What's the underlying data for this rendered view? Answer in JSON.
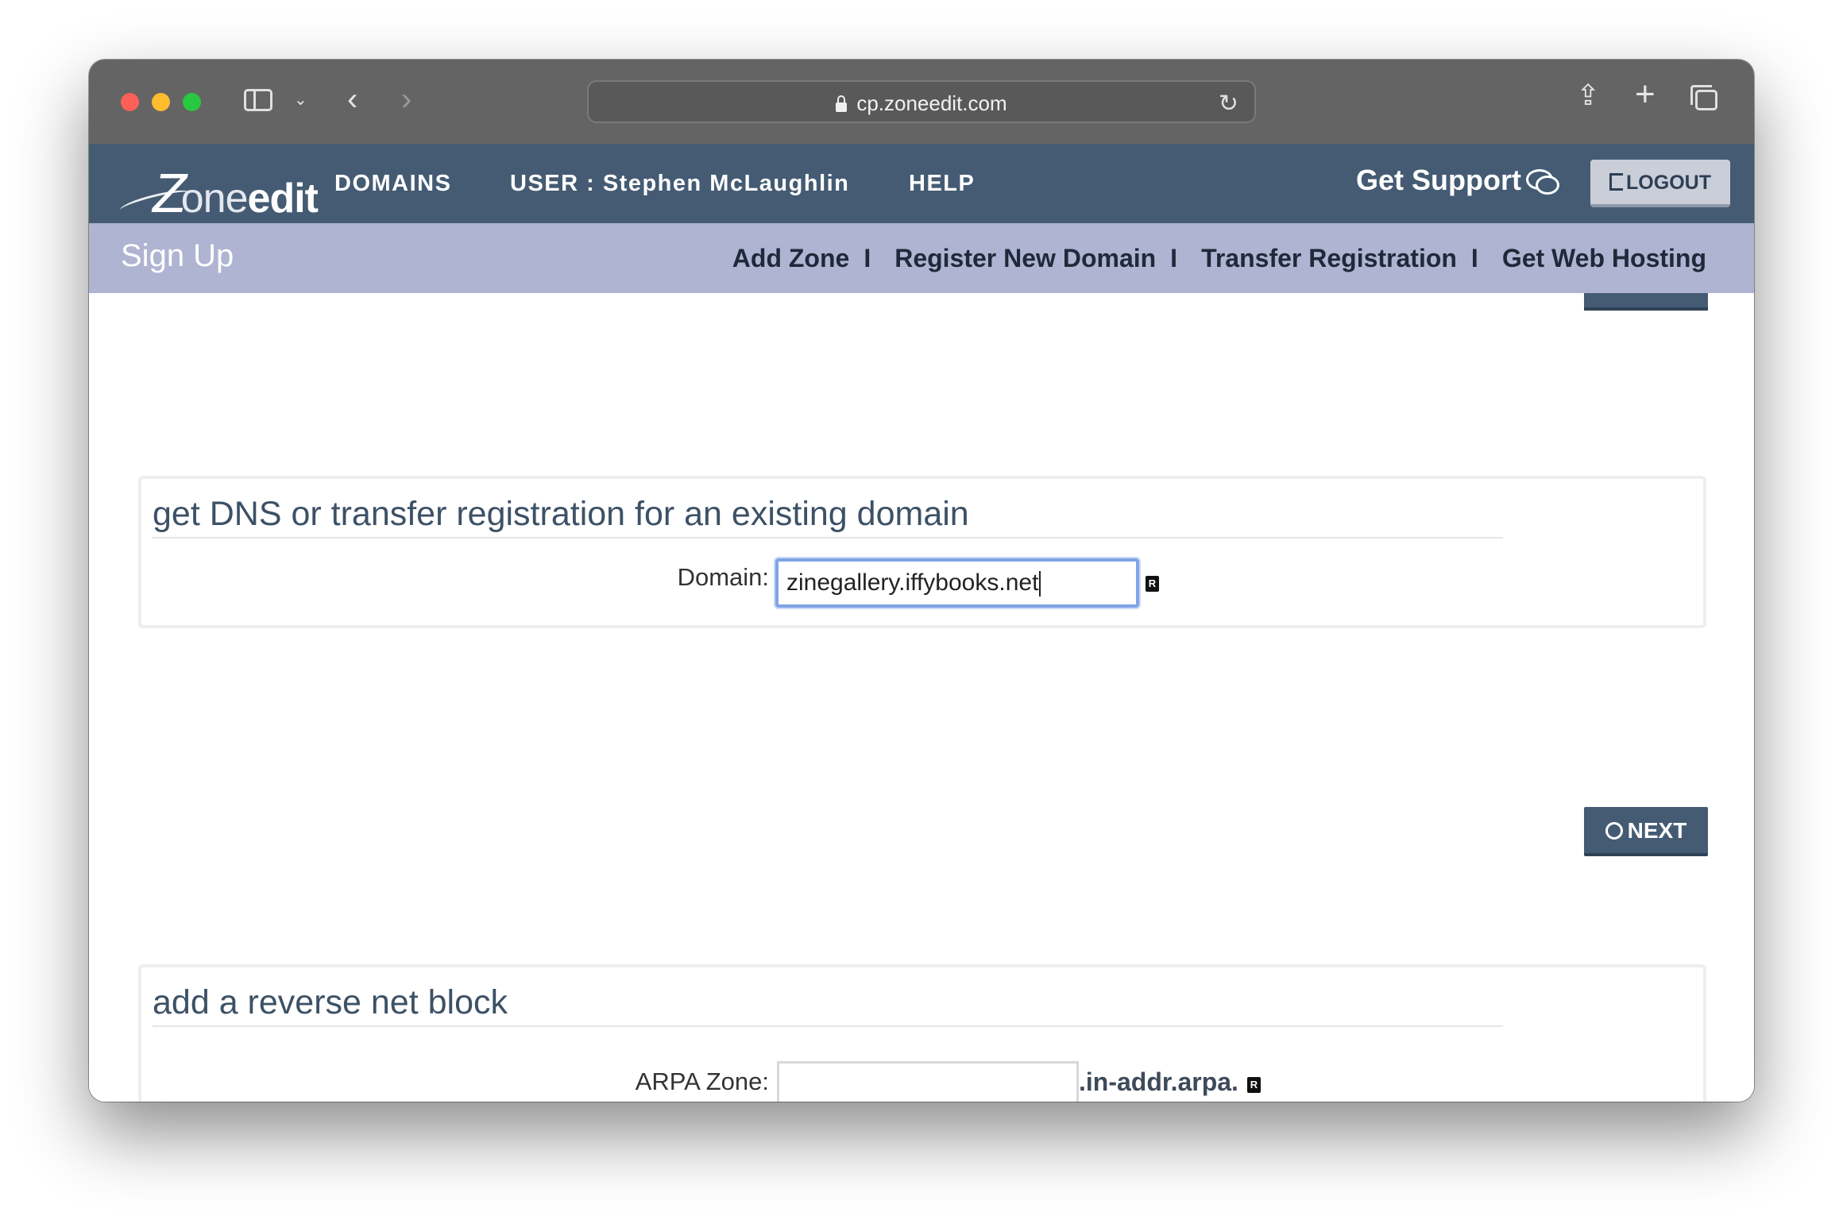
{
  "browser": {
    "url": "cp.zoneedit.com"
  },
  "header": {
    "logo_z": "Z",
    "logo_one": "one",
    "logo_edit": "edit",
    "nav": {
      "domains": "DOMAINS",
      "user": "USER : Stephen McLaughlin",
      "help": "HELP"
    },
    "support": "Get Support",
    "logout": "LOGOUT"
  },
  "subnav": {
    "title": "Sign Up",
    "links": [
      "Add Zone",
      "Register New Domain",
      "Transfer Registration",
      "Get Web Hosting"
    ],
    "separator": "I"
  },
  "dns_panel": {
    "title": "get DNS or transfer registration for an existing domain",
    "domain_label": "Domain:",
    "domain_value": "zinegallery.iffybooks.net",
    "help_icon": "R"
  },
  "next_button": "NEXT",
  "reverse_panel": {
    "title": "add a reverse net block",
    "arpa_label": "ARPA Zone:",
    "arpa_value": "",
    "arpa_suffix": ".in-addr.arpa.",
    "help_icon": "R"
  }
}
